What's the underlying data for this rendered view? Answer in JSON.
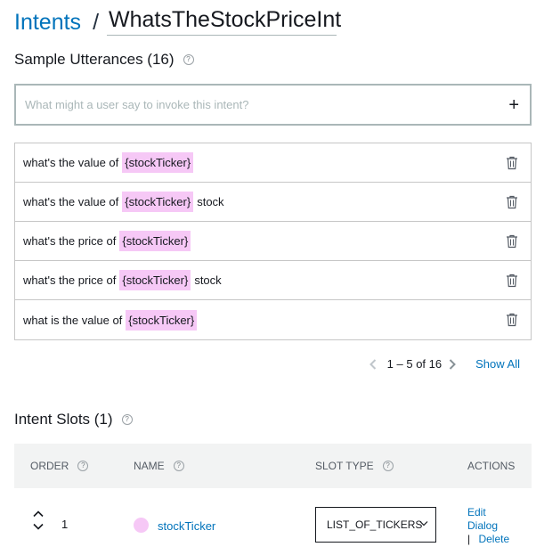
{
  "header": {
    "breadcrumb_link": "Intents",
    "separator": "/",
    "intent_name": "WhatsTheStockPriceInt"
  },
  "utterances": {
    "title": "Sample Utterances (16)",
    "input_placeholder": "What might a user say to invoke this intent?",
    "add_label": "+",
    "items": [
      {
        "before": "what's the value of",
        "slot": "{stockTicker}",
        "after": ""
      },
      {
        "before": "what's the value of",
        "slot": "{stockTicker}",
        "after": "stock"
      },
      {
        "before": "what's the price of",
        "slot": "{stockTicker}",
        "after": ""
      },
      {
        "before": "what's the price of",
        "slot": "{stockTicker}",
        "after": "stock"
      },
      {
        "before": "what is the value of",
        "slot": "{stockTicker}",
        "after": ""
      }
    ],
    "pagination": {
      "range": "1 – 5 of 16",
      "show_all": "Show All"
    }
  },
  "slots": {
    "title": "Intent Slots (1)",
    "columns": {
      "order": "ORDER",
      "name": "NAME",
      "slot_type": "SLOT TYPE",
      "actions": "ACTIONS"
    },
    "rows": [
      {
        "order": "1",
        "name": "stockTicker",
        "slot_type": "LIST_OF_TICKERS",
        "edit_dialog": "Edit Dialog",
        "separator": "|",
        "delete": "Delete"
      }
    ]
  },
  "colors": {
    "link": "#0073bb",
    "slot_highlight": "#f6c8f6",
    "header_bg": "#f2f3f3"
  },
  "icons": [
    "help-icon",
    "plus-icon",
    "trash-icon",
    "chevron-left-icon",
    "chevron-right-icon",
    "reorder-up-icon",
    "reorder-down-icon",
    "chevron-down-icon"
  ]
}
